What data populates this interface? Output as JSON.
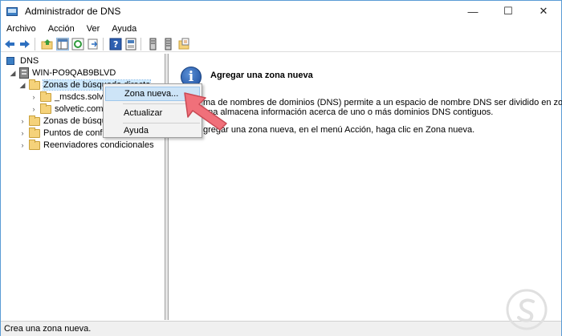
{
  "window": {
    "title": "Administrador de DNS"
  },
  "menu": [
    "Archivo",
    "Acción",
    "Ver",
    "Ayuda"
  ],
  "tree": {
    "root": "DNS",
    "server": "WIN-PO9QAB9BLVD",
    "items": [
      {
        "label": "Zonas de búsqueda directa",
        "selected": true
      },
      {
        "label": "_msdcs.solveti"
      },
      {
        "label": "solvetic.com"
      },
      {
        "label": "Zonas de búsqued"
      },
      {
        "label": "Puntos de confiar"
      },
      {
        "label": "Reenviadores condicionales"
      }
    ]
  },
  "context_menu": {
    "items": [
      "Zona nueva...",
      "Actualizar",
      "Ayuda"
    ],
    "highlighted": "Zona nueva..."
  },
  "info": {
    "title": "Agregar una zona nueva",
    "lines": [
      "ma de nombres de dominios (DNS) permite a un espacio de nombre DNS ser dividido en zonas.",
      "ona almacena información acerca de uno o más dominios DNS contiguos.",
      "gregar una zona nueva, en el menú Acción, haga clic en Zona nueva."
    ]
  },
  "status": {
    "text": "Crea una zona nueva."
  },
  "colors": {
    "accent": "#3c7fc4",
    "arrow": "#f0707a",
    "highlight": "#cde4f7"
  },
  "icons": [
    "back-arrow-icon",
    "forward-arrow-icon",
    "up-folder-icon",
    "show-hide-tree-icon",
    "refresh-icon",
    "export-list-icon",
    "help-icon",
    "properties-icon",
    "server-icon",
    "folder-icon",
    "info-icon"
  ]
}
